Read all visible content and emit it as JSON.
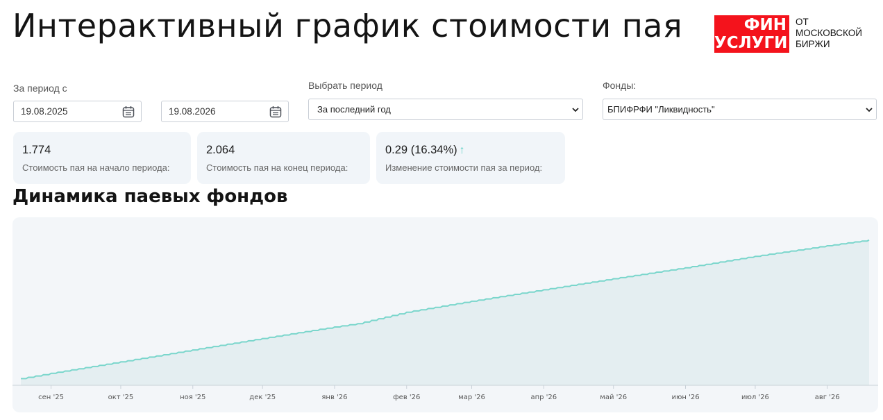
{
  "title": "Интерактивный график стоимости пая",
  "logo": {
    "line1": "ФИН",
    "line2": "УСЛУГИ",
    "sub1": "ОТ",
    "sub2": "МОСКОВСКОЙ",
    "sub3": "БИРЖИ",
    "color": "#f4131c"
  },
  "filters": {
    "period_from_label": "За период с",
    "date_from": "19.08.2025",
    "date_to": "19.08.2026",
    "period_select_label": "Выбрать период",
    "period_select_value": "За последний год",
    "funds_label": "Фонды:",
    "funds_value": "БПИФРФИ \"Ликвидность\""
  },
  "stats": [
    {
      "value": "1.774",
      "label": "Стоимость пая на начало периода:"
    },
    {
      "value": "2.064",
      "label": "Стоимость пая на конец периода:"
    },
    {
      "value": "0.29 (16.34%)",
      "arrow": "↑",
      "label": "Изменение стоимости пая за период:"
    }
  ],
  "chart_section_title": "Динамика паевых фондов",
  "chart_data": {
    "type": "area",
    "x_ticks": [
      "сен '25",
      "окт '25",
      "ноя '25",
      "дек '25",
      "янв '26",
      "фев '26",
      "мар '26",
      "апр '26",
      "май '26",
      "июн '26",
      "июл '26",
      "авг '26"
    ],
    "series": [
      {
        "x": [
          "19.08.2025",
          "01.09.2025",
          "01.10.2025",
          "01.11.2025",
          "01.12.2025",
          "01.01.2026",
          "11.01.2026",
          "01.02.2026",
          "01.03.2026",
          "01.04.2026",
          "01.05.2026",
          "01.06.2026",
          "01.07.2026",
          "01.08.2026",
          "19.08.2026"
        ],
        "y": [
          1.774,
          1.785,
          1.809,
          1.834,
          1.858,
          1.882,
          1.889,
          1.913,
          1.936,
          1.96,
          1.983,
          2.006,
          2.03,
          2.052,
          2.064
        ]
      }
    ],
    "ylim": [
      1.76,
      2.1
    ],
    "grid": false,
    "line_color": "#7ad6cc",
    "fill_color": "#e4eef1"
  }
}
